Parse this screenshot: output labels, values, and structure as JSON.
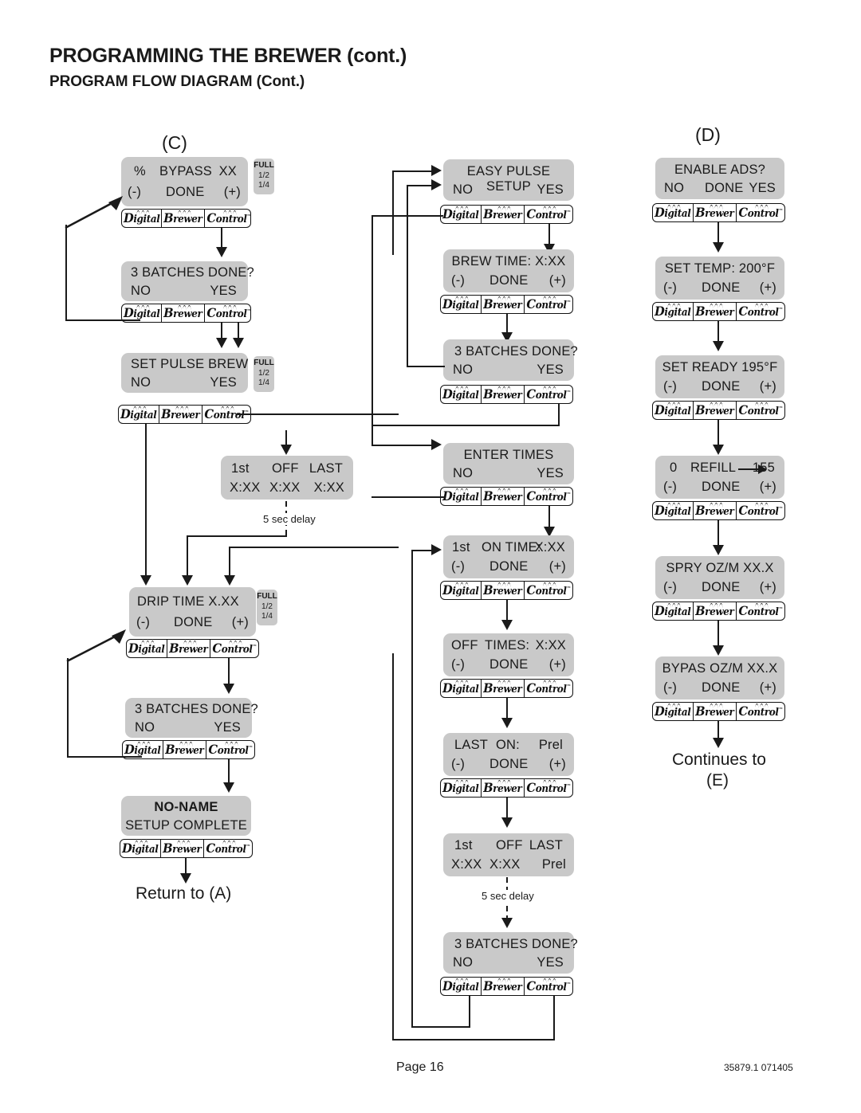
{
  "header": {
    "title": "PROGRAMMING THE BREWER (cont.)",
    "subtitle": "PROGRAM FLOW DIAGRAM (Cont.)"
  },
  "markers": {
    "c": "(C)",
    "d": "(D)"
  },
  "keypad": {
    "keys": [
      "Digital",
      "Brewer",
      "Control"
    ],
    "trademark": "™"
  },
  "labels": {
    "full": "FULL",
    "half": "1/2",
    "quarter": "1/4",
    "delay": "5 sec delay",
    "return_to_a": "Return to (A)",
    "continues_to": "Continues to",
    "continues_target": "(E)"
  },
  "footer": {
    "page": "Page 16",
    "code": "35879.1 071405"
  },
  "columns": {
    "c": [
      {
        "id": "pct-bypass",
        "line1": [
          "%",
          "BYPASS",
          "XX"
        ],
        "line2": [
          "(-)",
          "DONE",
          "(+)"
        ],
        "full_tab": true,
        "keypad": true
      },
      {
        "id": "batches-done-1",
        "line1": [
          "3 BATCHES DONE?"
        ],
        "line2": [
          "NO",
          "YES"
        ],
        "full_tab": false,
        "keypad": true
      },
      {
        "id": "set-pulse-brew",
        "line1": [
          "SET PULSE BREW"
        ],
        "line2": [
          "NO",
          "YES"
        ],
        "full_tab": true,
        "keypad": true
      },
      {
        "id": "first-off-last-c",
        "line1": [
          "1st",
          "OFF",
          "LAST"
        ],
        "line2": [
          "X:XX",
          "X:XX",
          "X:XX"
        ],
        "full_tab": false,
        "keypad": false
      },
      {
        "id": "drip-time",
        "line1": [
          "DRIP  TIME  X.XX"
        ],
        "line2": [
          "(-)",
          "DONE",
          "(+)"
        ],
        "full_tab": true,
        "keypad": true
      },
      {
        "id": "batches-done-2",
        "line1": [
          "3 BATCHES DONE?"
        ],
        "line2": [
          "NO",
          "YES"
        ],
        "full_tab": false,
        "keypad": true
      },
      {
        "id": "no-name-complete",
        "line1": [
          "NO-NAME"
        ],
        "line2": [
          "SETUP COMPLETE"
        ],
        "full_tab": false,
        "keypad": true
      }
    ],
    "middle": [
      {
        "id": "easy-pulse-setup",
        "line1": [
          "EASY PULSE SETUP"
        ],
        "line2": [
          "NO",
          "YES"
        ],
        "keypad": true
      },
      {
        "id": "brew-time",
        "line1": [
          "BREW TIME: X:XX"
        ],
        "line2": [
          "(-)",
          "DONE",
          "(+)"
        ],
        "keypad": true
      },
      {
        "id": "batches-done-3",
        "line1": [
          "3 BATCHES DONE?"
        ],
        "line2": [
          "NO",
          "YES"
        ],
        "keypad": true
      },
      {
        "id": "enter-times",
        "line1": [
          "ENTER TIMES"
        ],
        "line2": [
          "NO",
          "YES"
        ],
        "keypad": true
      },
      {
        "id": "first-on-time",
        "line1": [
          "1st",
          "ON TIME:",
          "X:XX"
        ],
        "line2": [
          "(-)",
          "DONE",
          "(+)"
        ],
        "keypad": true
      },
      {
        "id": "off-times",
        "line1": [
          "OFF",
          "TIMES:",
          "X:XX"
        ],
        "line2": [
          "(-)",
          "DONE",
          "(+)"
        ],
        "keypad": true
      },
      {
        "id": "last-on",
        "line1": [
          "LAST",
          "ON:",
          "Prel"
        ],
        "line2": [
          "(-)",
          "DONE",
          "(+)"
        ],
        "keypad": true
      },
      {
        "id": "first-off-last-m",
        "line1": [
          "1st",
          "OFF",
          "LAST"
        ],
        "line2": [
          "X:XX",
          "X:XX",
          "Prel"
        ],
        "keypad": false
      },
      {
        "id": "batches-done-4",
        "line1": [
          "3 BATCHES DONE?"
        ],
        "line2": [
          "NO",
          "YES"
        ],
        "keypad": true
      }
    ],
    "d": [
      {
        "id": "enable-ads",
        "line1": [
          "ENABLE  ADS?"
        ],
        "line2": [
          "NO",
          "DONE",
          "YES"
        ],
        "keypad": true
      },
      {
        "id": "set-temp",
        "line1": [
          "SET TEMP: 200°F"
        ],
        "line2": [
          "(-)",
          "DONE",
          "(+)"
        ],
        "keypad": true
      },
      {
        "id": "set-ready",
        "line1": [
          "SET READY  195°F"
        ],
        "line2": [
          "(-)",
          "DONE",
          "(+)"
        ],
        "keypad": true
      },
      {
        "id": "refill",
        "line1": [
          "0",
          "REFILL",
          "155"
        ],
        "line2": [
          "(-)",
          "DONE",
          "(+)"
        ],
        "keypad": true,
        "inline_arrow": true
      },
      {
        "id": "spry-ozm",
        "line1": [
          "SPRY OZ/M  XX.X"
        ],
        "line2": [
          "(-)",
          "DONE",
          "(+)"
        ],
        "keypad": true
      },
      {
        "id": "bypas-ozm",
        "line1": [
          "BYPAS OZ/M  XX.X"
        ],
        "line2": [
          "(-)",
          "DONE",
          "(+)"
        ],
        "keypad": true
      }
    ]
  }
}
